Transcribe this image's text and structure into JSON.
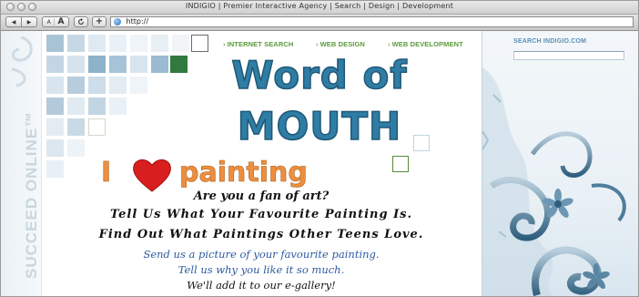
{
  "window": {
    "title": "INDIGIO | Premier Interactive Agency | Search | Design | Development"
  },
  "toolbar": {
    "back_label": "◀",
    "forward_label": "▶",
    "text_smaller": "A",
    "text_larger": "A",
    "reload_icon": "reload-icon",
    "add_icon": "plus-icon",
    "url": "http://"
  },
  "nav": {
    "items": [
      {
        "label": "INTERNET SEARCH"
      },
      {
        "label": "WEB DESIGN"
      },
      {
        "label": "WEB DEVELOPMENT"
      }
    ]
  },
  "side": {
    "vertical_text": "SUCCEED ONLINE™"
  },
  "headline": {
    "line1": "Word of",
    "line2": "MOUTH"
  },
  "love": {
    "i": "I",
    "word": "painting"
  },
  "body": {
    "question": "Are you a fan of art?",
    "line1": "Tell Us What Your Favourite Painting Is.",
    "line2": "Find Out What Paintings Other Teens Love.",
    "blue1": "Send us a picture of your favourite painting.",
    "blue2": "Tell us why you like it so much.",
    "black1": "We'll add it to our e-gallery!"
  },
  "search": {
    "label": "SEARCH INDIGIO.COM",
    "value": ""
  },
  "colors": {
    "nav_green": "#5b9a3c",
    "headline_blue": "#2f7da4",
    "heart_red": "#d81e1e",
    "painting_orange": "#ec8f3e",
    "body_blue": "#2d5aa0"
  }
}
